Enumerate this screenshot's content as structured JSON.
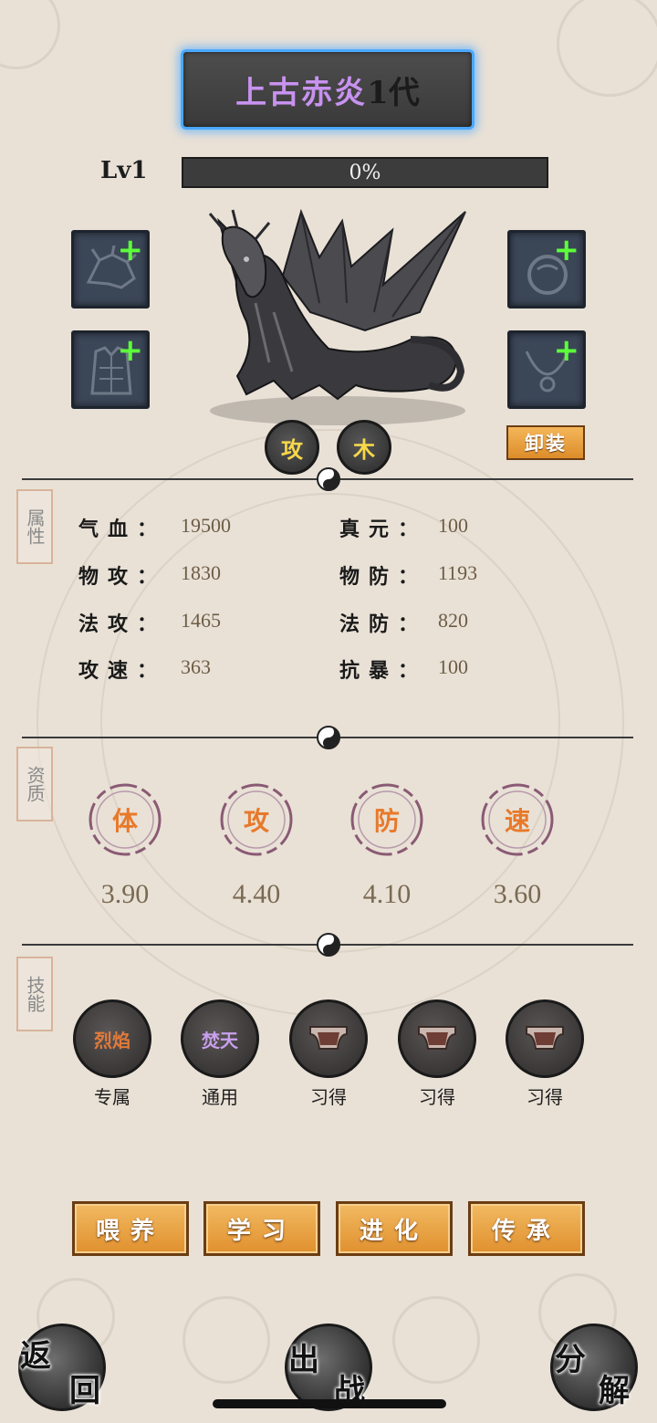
{
  "pet": {
    "name": "上古赤炎",
    "generation": "1代",
    "level": "Lv1",
    "exp_percent": 0,
    "exp_text": "0%",
    "types": [
      "攻",
      "木"
    ]
  },
  "equipment": {
    "unequip_label": "卸装",
    "slots": [
      {
        "icon": "helmet-icon"
      },
      {
        "icon": "ring-icon"
      },
      {
        "icon": "armor-icon"
      },
      {
        "icon": "necklace-icon"
      }
    ],
    "add_symbol": "+"
  },
  "attributes": {
    "tag": "属性",
    "items": [
      {
        "label": "气血：",
        "value": "19500"
      },
      {
        "label": "真元：",
        "value": "100"
      },
      {
        "label": "物攻：",
        "value": "1830"
      },
      {
        "label": "物防：",
        "value": "1193"
      },
      {
        "label": "法攻：",
        "value": "1465"
      },
      {
        "label": "法防：",
        "value": "820"
      },
      {
        "label": "攻速：",
        "value": "363"
      },
      {
        "label": "抗暴：",
        "value": "100"
      }
    ]
  },
  "aptitude": {
    "tag": "资质",
    "items": [
      {
        "label": "体",
        "value": "3.90"
      },
      {
        "label": "攻",
        "value": "4.40"
      },
      {
        "label": "防",
        "value": "4.10"
      },
      {
        "label": "速",
        "value": "3.60"
      }
    ]
  },
  "skills": {
    "tag": "技能",
    "items": [
      {
        "name": "烈焰",
        "label": "专属",
        "color": "#e07a3a",
        "locked": false
      },
      {
        "name": "焚天",
        "label": "通用",
        "color": "#c9a0ee",
        "locked": false
      },
      {
        "name": "",
        "label": "习得",
        "color": "",
        "locked": true
      },
      {
        "name": "",
        "label": "习得",
        "color": "",
        "locked": true
      },
      {
        "name": "",
        "label": "习得",
        "color": "",
        "locked": true
      }
    ]
  },
  "actions": [
    "喂养",
    "学习",
    "进化",
    "传承"
  ],
  "bottom_nav": {
    "back": [
      "返",
      "回"
    ],
    "battle": [
      "出",
      "战"
    ],
    "decompose": [
      "分",
      "解"
    ]
  },
  "colors": {
    "title_glow": "#4aa8ff",
    "pet_name": "#c892f0",
    "type_text": "#f6d84a",
    "aptitude_text": "#e8792a",
    "button_orange": "#e0902e",
    "plus_green": "#5cff3a"
  }
}
